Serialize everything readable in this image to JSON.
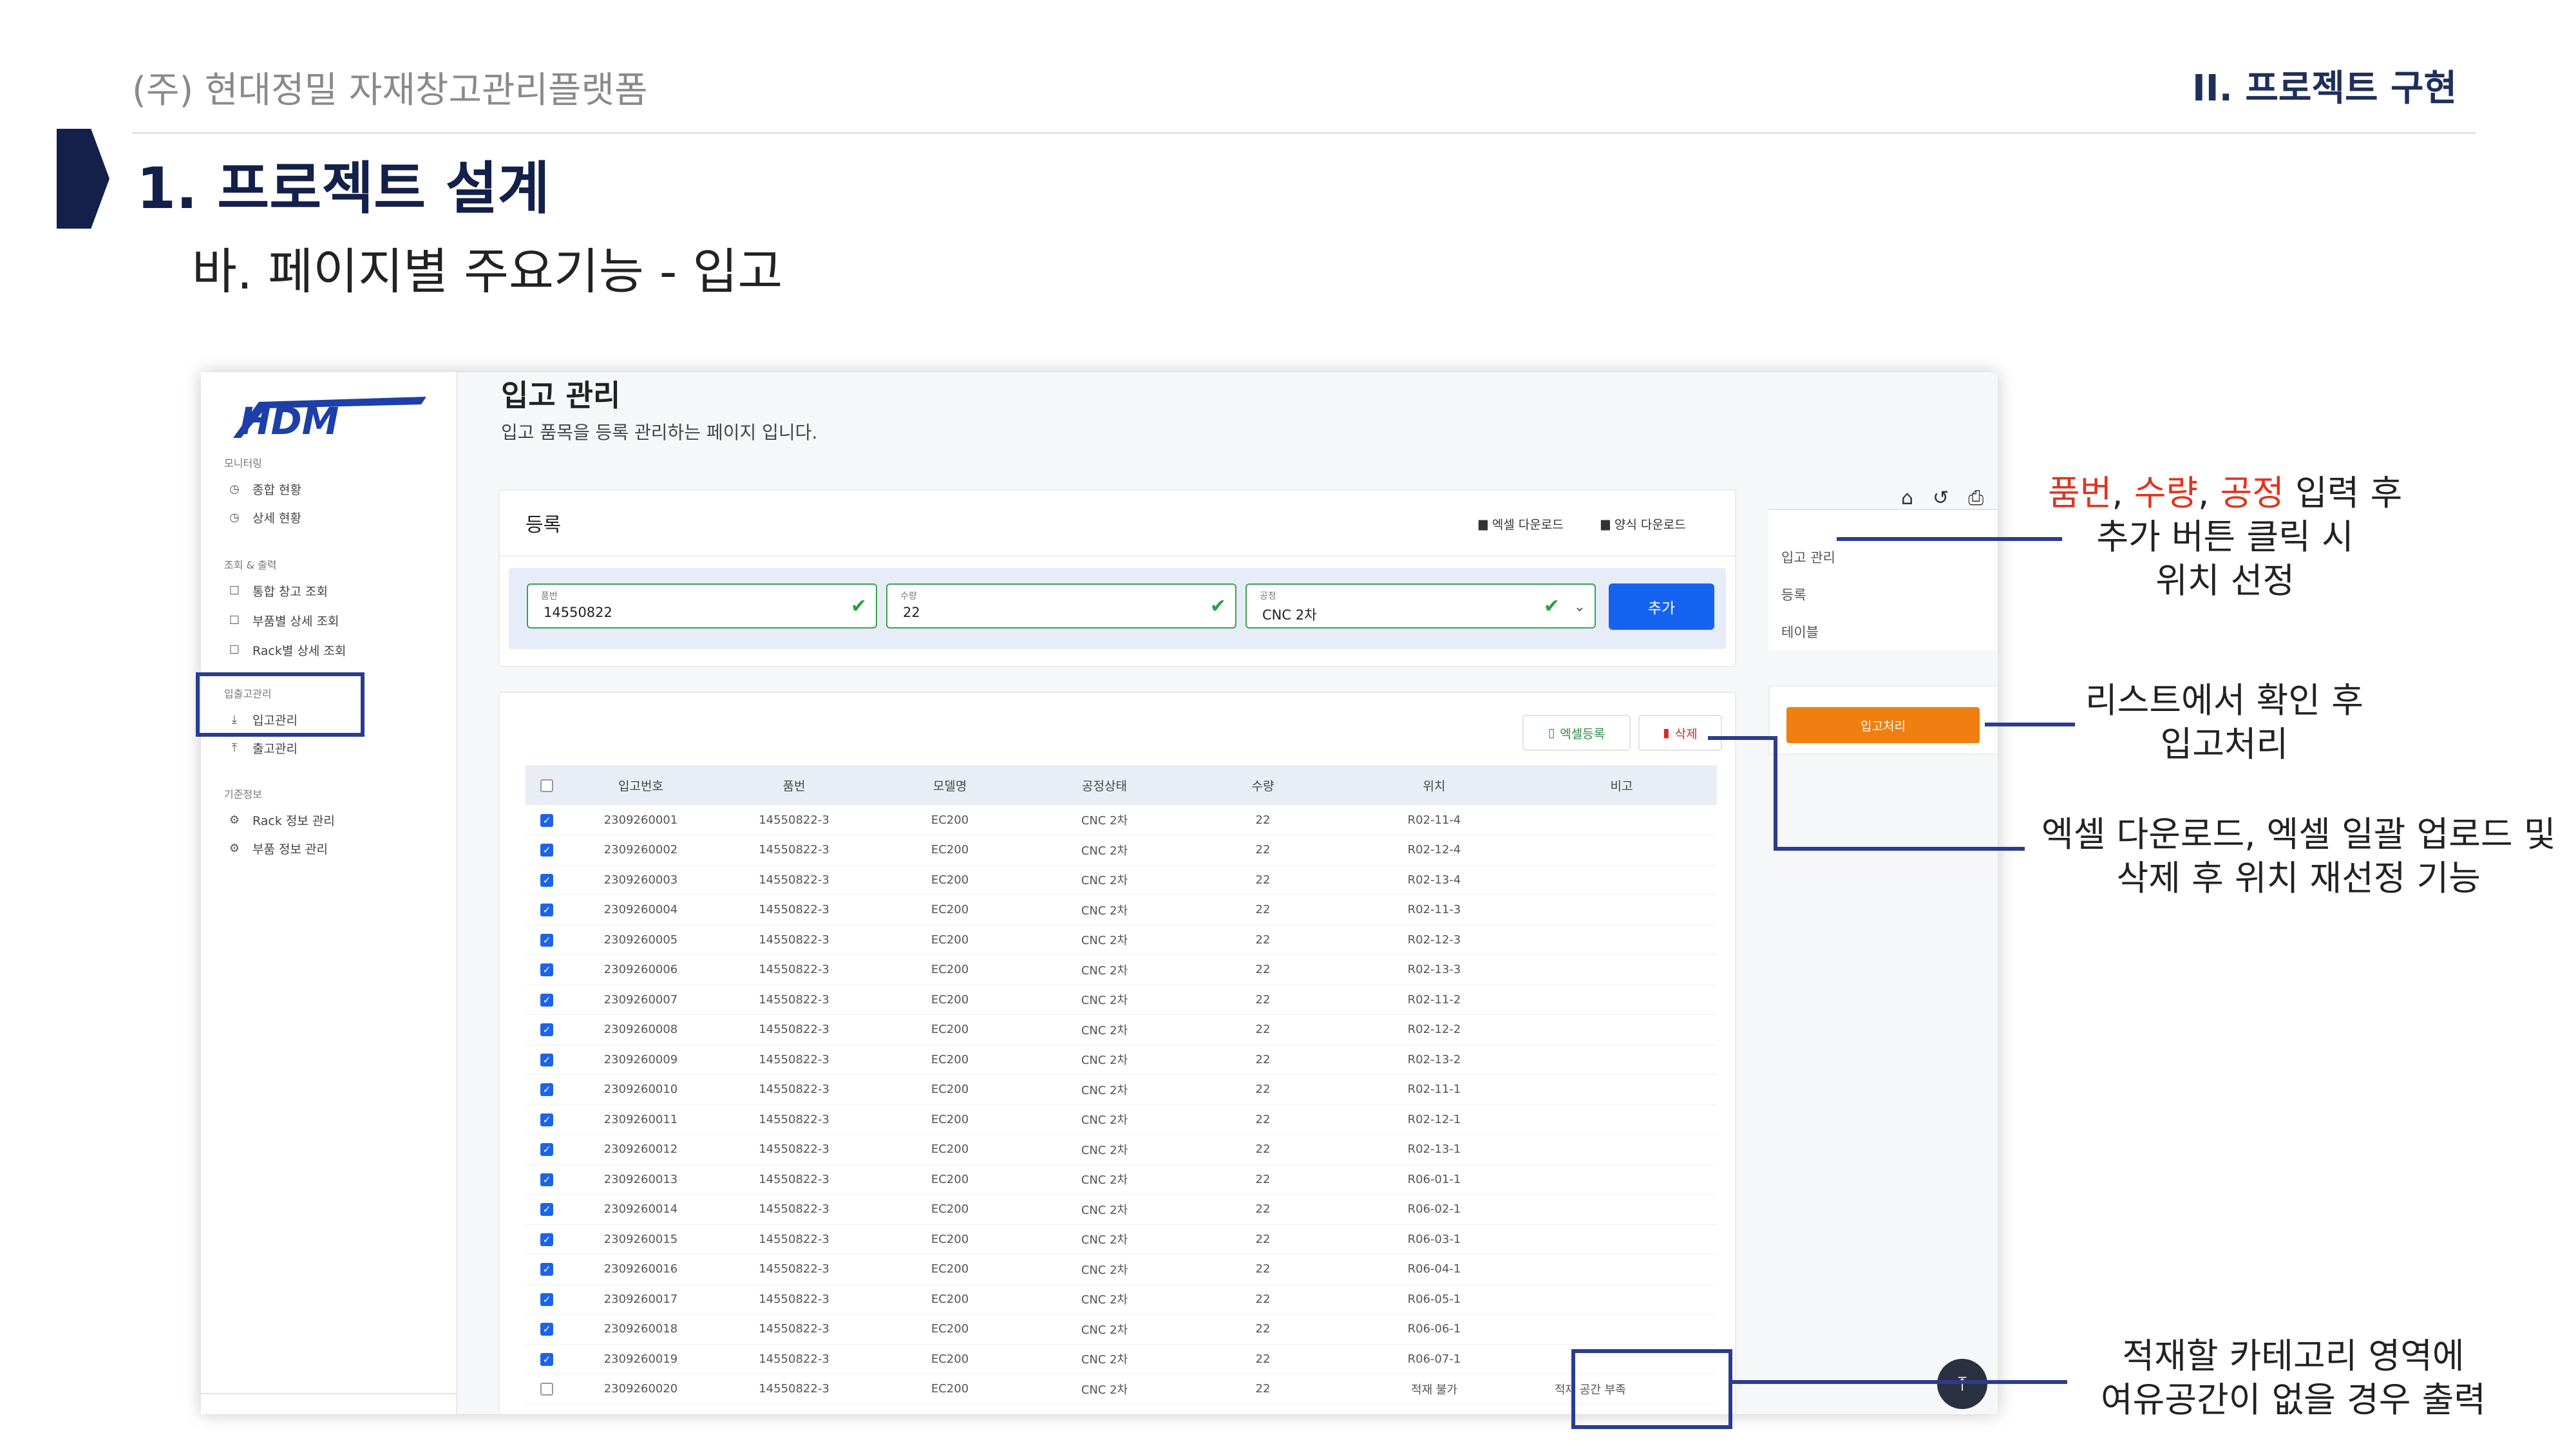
{
  "slide": {
    "company": "(주) 현대정밀 자재창고관리플랫폼",
    "section": "II. 프로젝트 구현",
    "title": "1. 프로젝트 설계",
    "subtitle": "바. 페이지별 주요기능 - 입고"
  },
  "app": {
    "logo": "HDM",
    "sidebar": {
      "groups": [
        {
          "heading": "모니터링",
          "items": [
            {
              "label": "종합 현황",
              "icon": "clock-icon"
            },
            {
              "label": "상세 현황",
              "icon": "clock-icon"
            }
          ]
        },
        {
          "heading": "조회 & 출력",
          "items": [
            {
              "label": "통합 창고 조회",
              "icon": "square-icon"
            },
            {
              "label": "부품별 상세 조회",
              "icon": "square-icon"
            },
            {
              "label": "Rack별 상세 조회",
              "icon": "square-icon"
            }
          ]
        },
        {
          "heading": "입출고관리",
          "items": [
            {
              "label": "입고관리",
              "icon": "download-icon"
            },
            {
              "label": "출고관리",
              "icon": "upload-icon"
            }
          ]
        },
        {
          "heading": "기준정보",
          "items": [
            {
              "label": "Rack 정보 관리",
              "icon": "gear-icon"
            },
            {
              "label": "부품 정보 관리",
              "icon": "gear-icon"
            }
          ]
        }
      ]
    },
    "page": {
      "title": "입고 관리",
      "description": "입고 품목을 등록 관리하는 페이지 입니다."
    },
    "register": {
      "title": "등록",
      "excel_download": "엑셀 다운로드",
      "template_download": "양식 다운로드",
      "fields": {
        "part_no": {
          "label": "품번",
          "value": "14550822"
        },
        "qty": {
          "label": "수량",
          "value": "22"
        },
        "process": {
          "label": "공정",
          "value": "CNC 2차"
        }
      },
      "add_button": "추가"
    },
    "list": {
      "excel_upload": "엑셀등록",
      "delete": "삭제",
      "columns": [
        "입고번호",
        "품번",
        "모델명",
        "공정상태",
        "수량",
        "위치",
        "비고"
      ],
      "rows": [
        {
          "checked": true,
          "no": "2309260001",
          "part": "14550822-3",
          "model": "EC200",
          "process": "CNC 2차",
          "qty": "22",
          "loc": "R02-11-4",
          "note": ""
        },
        {
          "checked": true,
          "no": "2309260002",
          "part": "14550822-3",
          "model": "EC200",
          "process": "CNC 2차",
          "qty": "22",
          "loc": "R02-12-4",
          "note": ""
        },
        {
          "checked": true,
          "no": "2309260003",
          "part": "14550822-3",
          "model": "EC200",
          "process": "CNC 2차",
          "qty": "22",
          "loc": "R02-13-4",
          "note": ""
        },
        {
          "checked": true,
          "no": "2309260004",
          "part": "14550822-3",
          "model": "EC200",
          "process": "CNC 2차",
          "qty": "22",
          "loc": "R02-11-3",
          "note": ""
        },
        {
          "checked": true,
          "no": "2309260005",
          "part": "14550822-3",
          "model": "EC200",
          "process": "CNC 2차",
          "qty": "22",
          "loc": "R02-12-3",
          "note": ""
        },
        {
          "checked": true,
          "no": "2309260006",
          "part": "14550822-3",
          "model": "EC200",
          "process": "CNC 2차",
          "qty": "22",
          "loc": "R02-13-3",
          "note": ""
        },
        {
          "checked": true,
          "no": "2309260007",
          "part": "14550822-3",
          "model": "EC200",
          "process": "CNC 2차",
          "qty": "22",
          "loc": "R02-11-2",
          "note": ""
        },
        {
          "checked": true,
          "no": "2309260008",
          "part": "14550822-3",
          "model": "EC200",
          "process": "CNC 2차",
          "qty": "22",
          "loc": "R02-12-2",
          "note": ""
        },
        {
          "checked": true,
          "no": "2309260009",
          "part": "14550822-3",
          "model": "EC200",
          "process": "CNC 2차",
          "qty": "22",
          "loc": "R02-13-2",
          "note": ""
        },
        {
          "checked": true,
          "no": "2309260010",
          "part": "14550822-3",
          "model": "EC200",
          "process": "CNC 2차",
          "qty": "22",
          "loc": "R02-11-1",
          "note": ""
        },
        {
          "checked": true,
          "no": "2309260011",
          "part": "14550822-3",
          "model": "EC200",
          "process": "CNC 2차",
          "qty": "22",
          "loc": "R02-12-1",
          "note": ""
        },
        {
          "checked": true,
          "no": "2309260012",
          "part": "14550822-3",
          "model": "EC200",
          "process": "CNC 2차",
          "qty": "22",
          "loc": "R02-13-1",
          "note": ""
        },
        {
          "checked": true,
          "no": "2309260013",
          "part": "14550822-3",
          "model": "EC200",
          "process": "CNC 2차",
          "qty": "22",
          "loc": "R06-01-1",
          "note": ""
        },
        {
          "checked": true,
          "no": "2309260014",
          "part": "14550822-3",
          "model": "EC200",
          "process": "CNC 2차",
          "qty": "22",
          "loc": "R06-02-1",
          "note": ""
        },
        {
          "checked": true,
          "no": "2309260015",
          "part": "14550822-3",
          "model": "EC200",
          "process": "CNC 2차",
          "qty": "22",
          "loc": "R06-03-1",
          "note": ""
        },
        {
          "checked": true,
          "no": "2309260016",
          "part": "14550822-3",
          "model": "EC200",
          "process": "CNC 2차",
          "qty": "22",
          "loc": "R06-04-1",
          "note": ""
        },
        {
          "checked": true,
          "no": "2309260017",
          "part": "14550822-3",
          "model": "EC200",
          "process": "CNC 2차",
          "qty": "22",
          "loc": "R06-05-1",
          "note": ""
        },
        {
          "checked": true,
          "no": "2309260018",
          "part": "14550822-3",
          "model": "EC200",
          "process": "CNC 2차",
          "qty": "22",
          "loc": "R06-06-1",
          "note": ""
        },
        {
          "checked": true,
          "no": "2309260019",
          "part": "14550822-3",
          "model": "EC200",
          "process": "CNC 2차",
          "qty": "22",
          "loc": "R06-07-1",
          "note": ""
        },
        {
          "checked": false,
          "no": "2309260020",
          "part": "14550822-3",
          "model": "EC200",
          "process": "CNC 2차",
          "qty": "22",
          "loc": "적재 불가",
          "note": "적재 공간 부족"
        }
      ]
    },
    "right_panel": {
      "icons": [
        "home-icon",
        "refresh-icon",
        "print-icon"
      ],
      "items": [
        "입고 관리",
        "등록",
        "테이블"
      ],
      "process_button": "입고처리"
    }
  },
  "callouts": {
    "c1": {
      "part_no": "품번",
      "comma1": ", ",
      "qty": "수량",
      "comma2": ", ",
      "process": "공정",
      "tail": " 입력 후",
      "line2": "추가 버튼 클릭 시",
      "line3": "위치 선정"
    },
    "c2": {
      "line1": "리스트에서 확인 후",
      "line2": "입고처리"
    },
    "c3": {
      "line1": "엑셀 다운로드, 엑셀 일괄 업로드 및",
      "line2": "삭제 후 위치 재선정 기능"
    },
    "c4": {
      "line1": "적재할 카테고리 영역에",
      "line2": "여유공간이 없을 경우 출력"
    }
  },
  "colors": {
    "navy": "#13204a",
    "accent_blue": "#1663f2",
    "orange": "#ef7f10",
    "red": "#e0341f",
    "highlight": "#2b3c8e"
  }
}
